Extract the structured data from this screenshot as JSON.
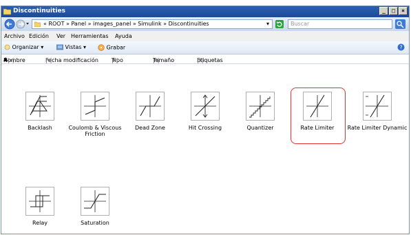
{
  "window": {
    "title": "Discontinuities",
    "buttons": [
      "_",
      "□",
      "×"
    ]
  },
  "address": {
    "path": "« ROOT » Panel » images_panel » Simulink » Discontinuities",
    "dropdown": "▾",
    "search_placeholder": "Buscar"
  },
  "menu": [
    "Archivo",
    "Edición",
    "Ver",
    "Herramientas",
    "Ayuda"
  ],
  "toolbar": {
    "organize": "Organizar ▾",
    "views": "Vistas ▾",
    "burn": "Grabar"
  },
  "columns": [
    "Nombre",
    "Fecha modificación",
    "Tipo",
    "Tamaño",
    "Etiquetas"
  ],
  "items": [
    {
      "label": "Backlash"
    },
    {
      "label": "Coulomb & Viscous Friction"
    },
    {
      "label": "Dead Zone"
    },
    {
      "label": "Hit Crossing"
    },
    {
      "label": "Quantizer"
    },
    {
      "label": "Rate Limiter",
      "selected": true
    },
    {
      "label": "Rate Limiter Dynamic"
    },
    {
      "label": "Relay"
    },
    {
      "label": "Saturation"
    }
  ],
  "colors": {
    "selection": "#e03030",
    "titlebar": "#2b5fb3"
  }
}
